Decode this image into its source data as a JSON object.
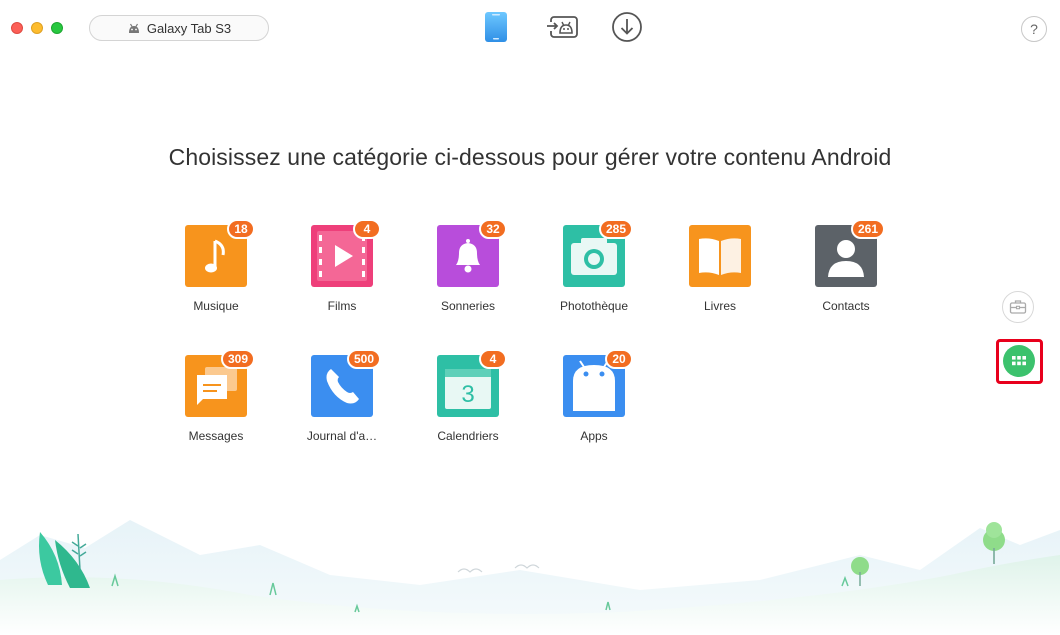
{
  "window": {
    "device_name": "Galaxy Tab S3",
    "help_label": "?"
  },
  "toolbar": {
    "modes": [
      "phone-manager-icon",
      "android-transfer-icon",
      "download-icon"
    ]
  },
  "main": {
    "headline": "Choisissez une catégorie ci-dessous pour gérer votre contenu Android"
  },
  "categories": [
    {
      "label": "Musique",
      "count": "18",
      "icon": "music-icon",
      "color": "#f7941d"
    },
    {
      "label": "Films",
      "count": "4",
      "icon": "film-icon",
      "color": "#ee3f7a"
    },
    {
      "label": "Sonneries",
      "count": "32",
      "icon": "bell-icon",
      "color": "#b84ddb"
    },
    {
      "label": "Photothèque",
      "count": "285",
      "icon": "camera-icon",
      "color": "#2ebfa5"
    },
    {
      "label": "Livres",
      "count": "",
      "icon": "book-icon",
      "color": "#f7941d"
    },
    {
      "label": "Contacts",
      "count": "261",
      "icon": "contact-icon",
      "color": "#5c6268"
    },
    {
      "label": "Messages",
      "count": "309",
      "icon": "message-icon",
      "color": "#f7941d"
    },
    {
      "label": "Journal d'a…",
      "count": "500",
      "icon": "phone-call-icon",
      "color": "#3b8ef0"
    },
    {
      "label": "Calendriers",
      "count": "4",
      "icon": "calendar-icon",
      "color": "#2ebfa5"
    },
    {
      "label": "Apps",
      "count": "20",
      "icon": "android-app-icon",
      "color": "#3b8ef0"
    }
  ],
  "sidebar": {
    "buttons": [
      "toolbox-icon",
      "apps-grid-icon"
    ]
  },
  "colors": {
    "badge": "#f26d21",
    "accent_green": "#3cc26d",
    "highlight": "#e8001c"
  },
  "calendar_day": "3"
}
